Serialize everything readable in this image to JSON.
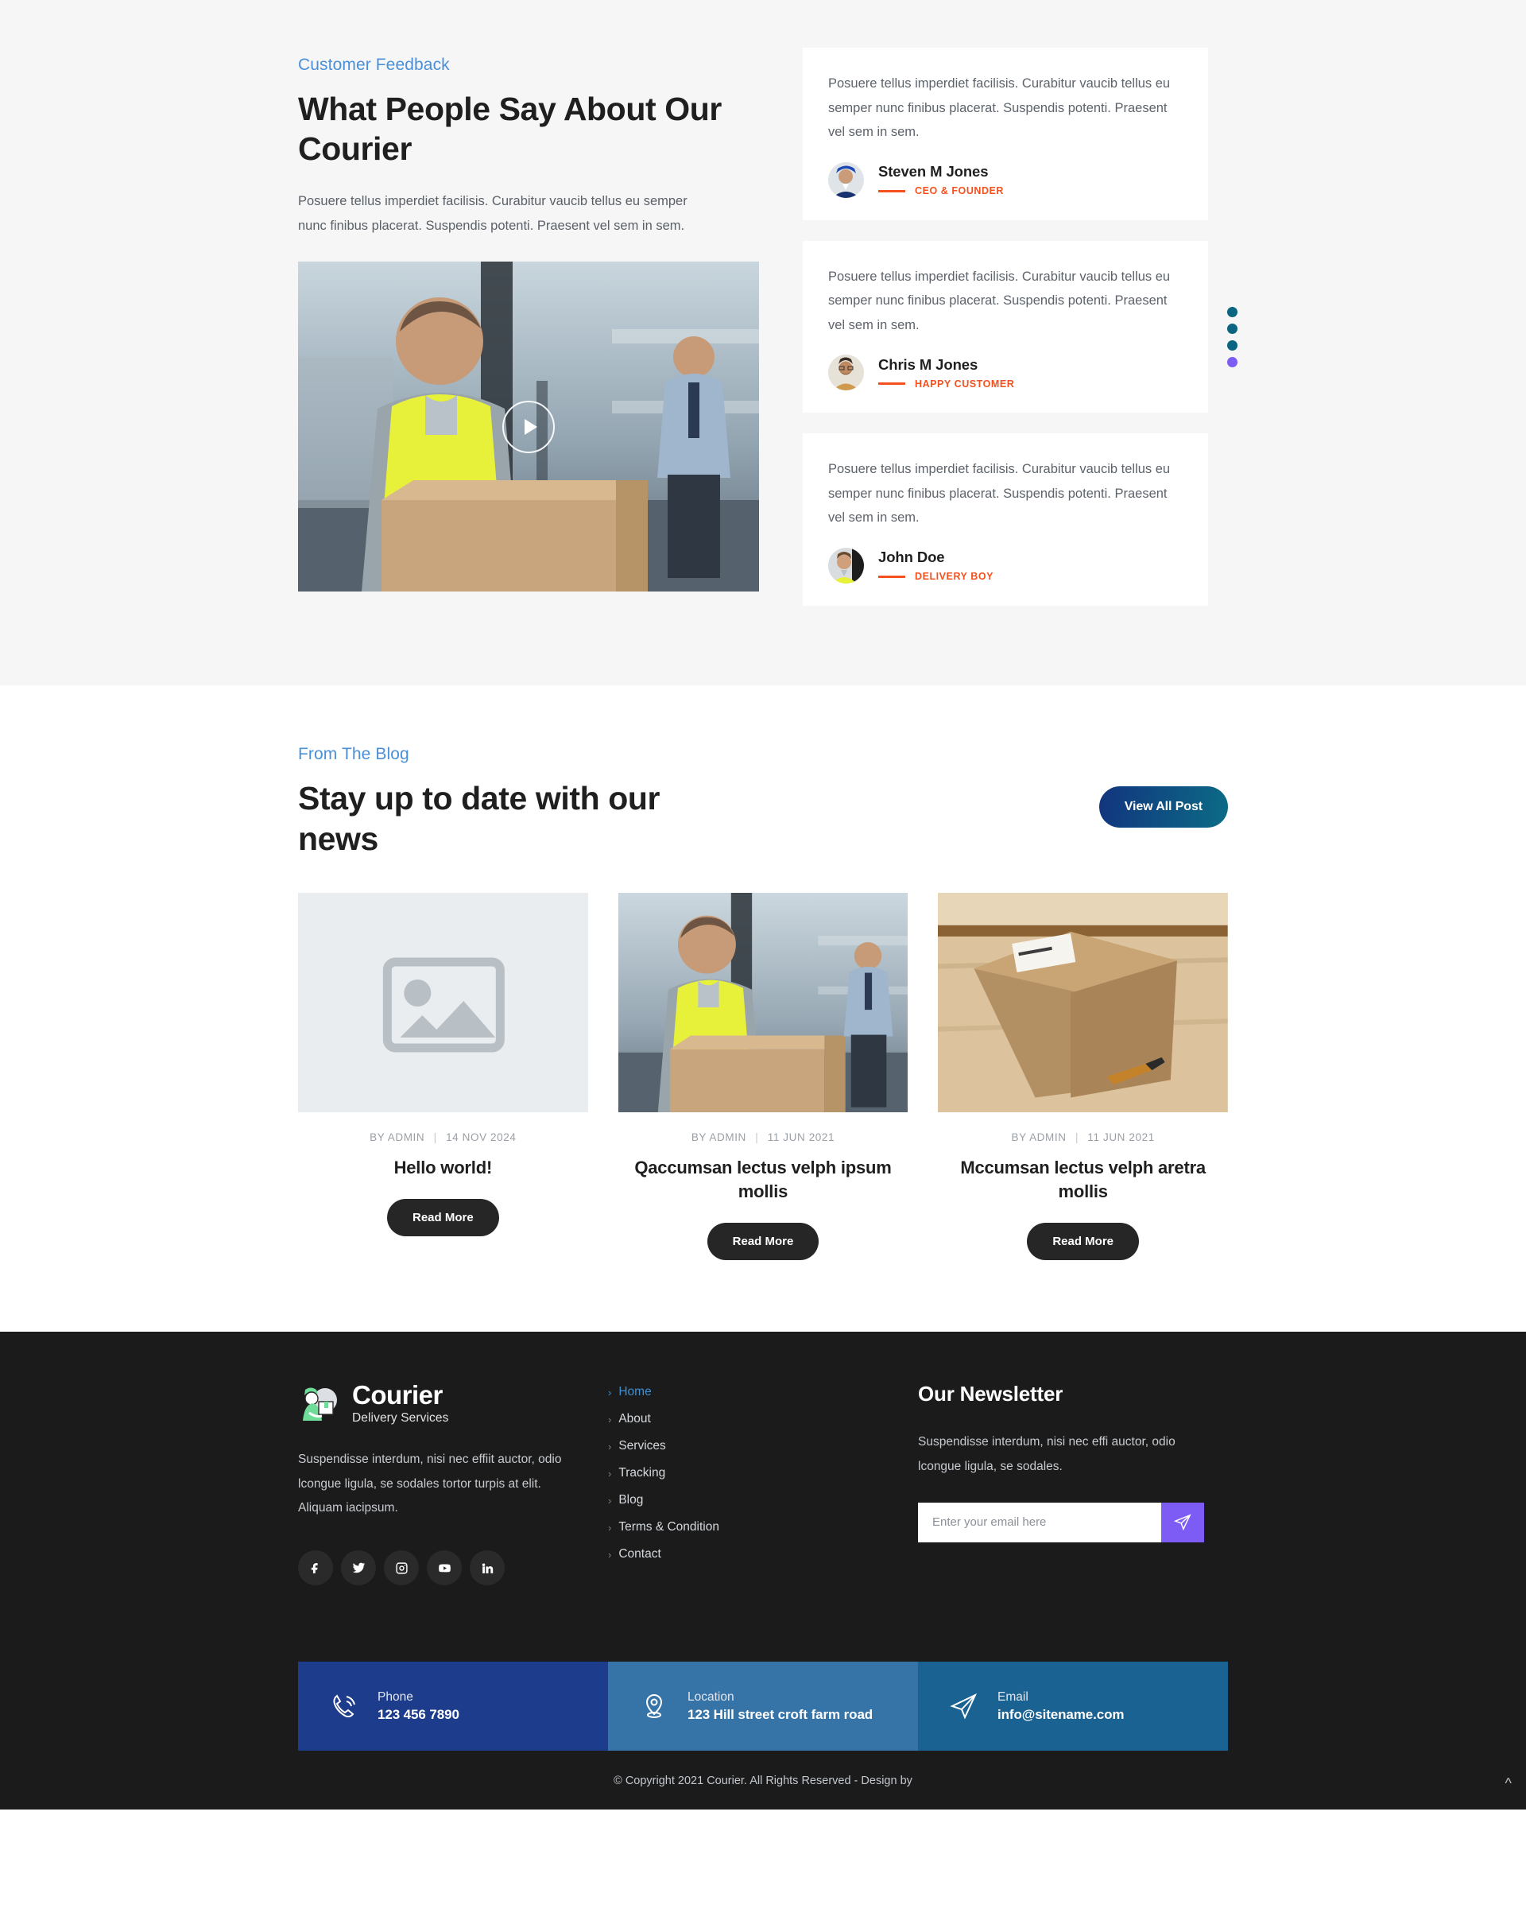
{
  "testimonials": {
    "eyebrow": "Customer Feedback",
    "title": "What People Say About Our Courier",
    "description": "Posuere tellus imperdiet facilisis. Curabitur vaucib tellus eu semper nunc finibus placerat. Suspendis potenti. Praesent vel sem in sem.",
    "video_play_label": "play-video",
    "cards": [
      {
        "text": "Posuere tellus imperdiet facilisis. Curabitur vaucib tellus eu semper nunc finibus placerat. Suspendis potenti. Praesent vel sem in sem.",
        "name": "Steven M Jones",
        "role": "CEO & FOUNDER"
      },
      {
        "text": "Posuere tellus imperdiet facilisis. Curabitur vaucib tellus eu semper nunc finibus placerat. Suspendis potenti. Praesent vel sem in sem.",
        "name": "Chris M Jones",
        "role": "HAPPY CUSTOMER"
      },
      {
        "text": "Posuere tellus imperdiet facilisis. Curabitur vaucib tellus eu semper nunc finibus placerat. Suspendis potenti. Praesent vel sem in sem.",
        "name": "John Doe",
        "role": "DELIVERY BOY"
      }
    ],
    "dots": [
      {
        "color": "#0b6480"
      },
      {
        "color": "#0b6480"
      },
      {
        "color": "#0b6480"
      },
      {
        "color": "#7c5cf5"
      }
    ]
  },
  "blog": {
    "eyebrow": "From The Blog",
    "title": "Stay up to date with our news",
    "view_all_label": "View All Post",
    "posts": [
      {
        "author": "BY ADMIN",
        "date": "14 NOV 2024",
        "title": "Hello world!",
        "read_more": "Read More",
        "image": "placeholder"
      },
      {
        "author": "BY ADMIN",
        "date": "11 JUN 2021",
        "title": "Qaccumsan lectus velph ipsum mollis",
        "read_more": "Read More",
        "image": "warehouse-worker"
      },
      {
        "author": "BY ADMIN",
        "date": "11 JUN 2021",
        "title": "Mccumsan lectus velph aretra mollis",
        "read_more": "Read More",
        "image": "package-box"
      }
    ]
  },
  "footer": {
    "brand_name": "Courier",
    "brand_sub": "Delivery Services",
    "about": "Suspendisse interdum, nisi nec effiit auctor, odio lcongue ligula, se sodales tortor turpis at elit. Aliquam iacipsum.",
    "socials": [
      {
        "name": "facebook"
      },
      {
        "name": "twitter"
      },
      {
        "name": "instagram"
      },
      {
        "name": "youtube"
      },
      {
        "name": "linkedin"
      }
    ],
    "links": [
      {
        "label": "Home",
        "active": true
      },
      {
        "label": "About",
        "active": false
      },
      {
        "label": "Services",
        "active": false
      },
      {
        "label": "Tracking",
        "active": false
      },
      {
        "label": "Blog",
        "active": false
      },
      {
        "label": "Terms & Condition",
        "active": false
      },
      {
        "label": "Contact",
        "active": false
      }
    ],
    "newsletter": {
      "title": "Our Newsletter",
      "description": "Suspendisse interdum, nisi nec effi auctor, odio lcongue ligula, se sodales.",
      "placeholder": "Enter your email here",
      "value": "",
      "submit_icon": "paper-plane-icon"
    },
    "contacts": [
      {
        "label": "Phone",
        "value": "123 456 7890",
        "icon": "phone-icon",
        "color": "#1e3c8c"
      },
      {
        "label": "Location",
        "value": "123 Hill street croft farm road",
        "icon": "map-pin-icon",
        "color": "#3673a7"
      },
      {
        "label": "Email",
        "value": "info@sitename.com",
        "icon": "paper-plane-icon",
        "color": "#1a6291"
      }
    ],
    "copyright": "© Copyright 2021 Courier. All Rights Reserved - Design by",
    "scroll_top": "^"
  }
}
